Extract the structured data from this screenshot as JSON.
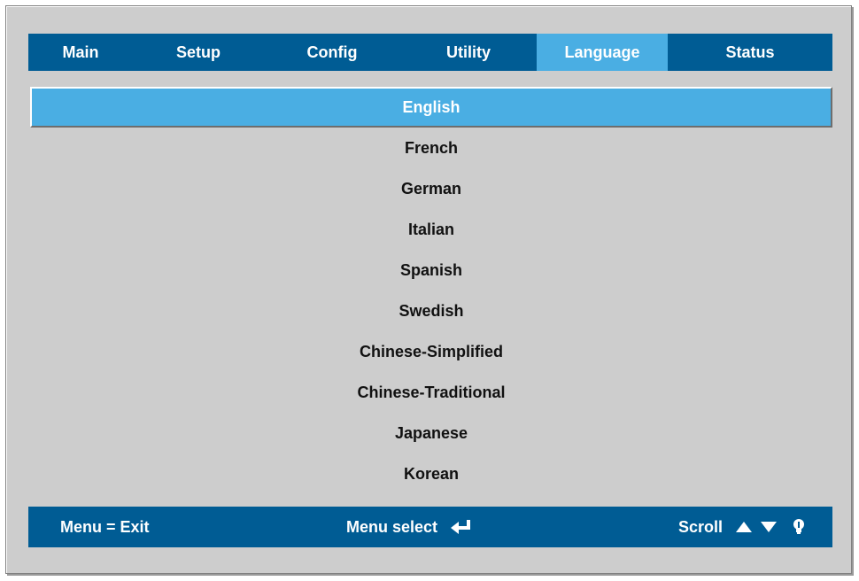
{
  "tabs": [
    {
      "label": "Main"
    },
    {
      "label": "Setup"
    },
    {
      "label": "Config"
    },
    {
      "label": "Utility"
    },
    {
      "label": "Language",
      "active": true
    },
    {
      "label": "Status"
    }
  ],
  "languages": [
    {
      "label": "English",
      "selected": true
    },
    {
      "label": "French"
    },
    {
      "label": "German"
    },
    {
      "label": "Italian"
    },
    {
      "label": "Spanish"
    },
    {
      "label": "Swedish"
    },
    {
      "label": "Chinese-Simplified"
    },
    {
      "label": "Chinese-Traditional"
    },
    {
      "label": "Japanese"
    },
    {
      "label": "Korean"
    }
  ],
  "footer": {
    "exit_label": "Menu = Exit",
    "select_label": "Menu select",
    "scroll_label": "Scroll",
    "select_icon": "enter-icon",
    "scroll_icons": [
      "arrow-up-icon",
      "arrow-down-icon",
      "bulb-icon"
    ]
  },
  "colors": {
    "bar": "#005c94",
    "highlight": "#4aaee3",
    "panel": "#cdcdcd"
  }
}
